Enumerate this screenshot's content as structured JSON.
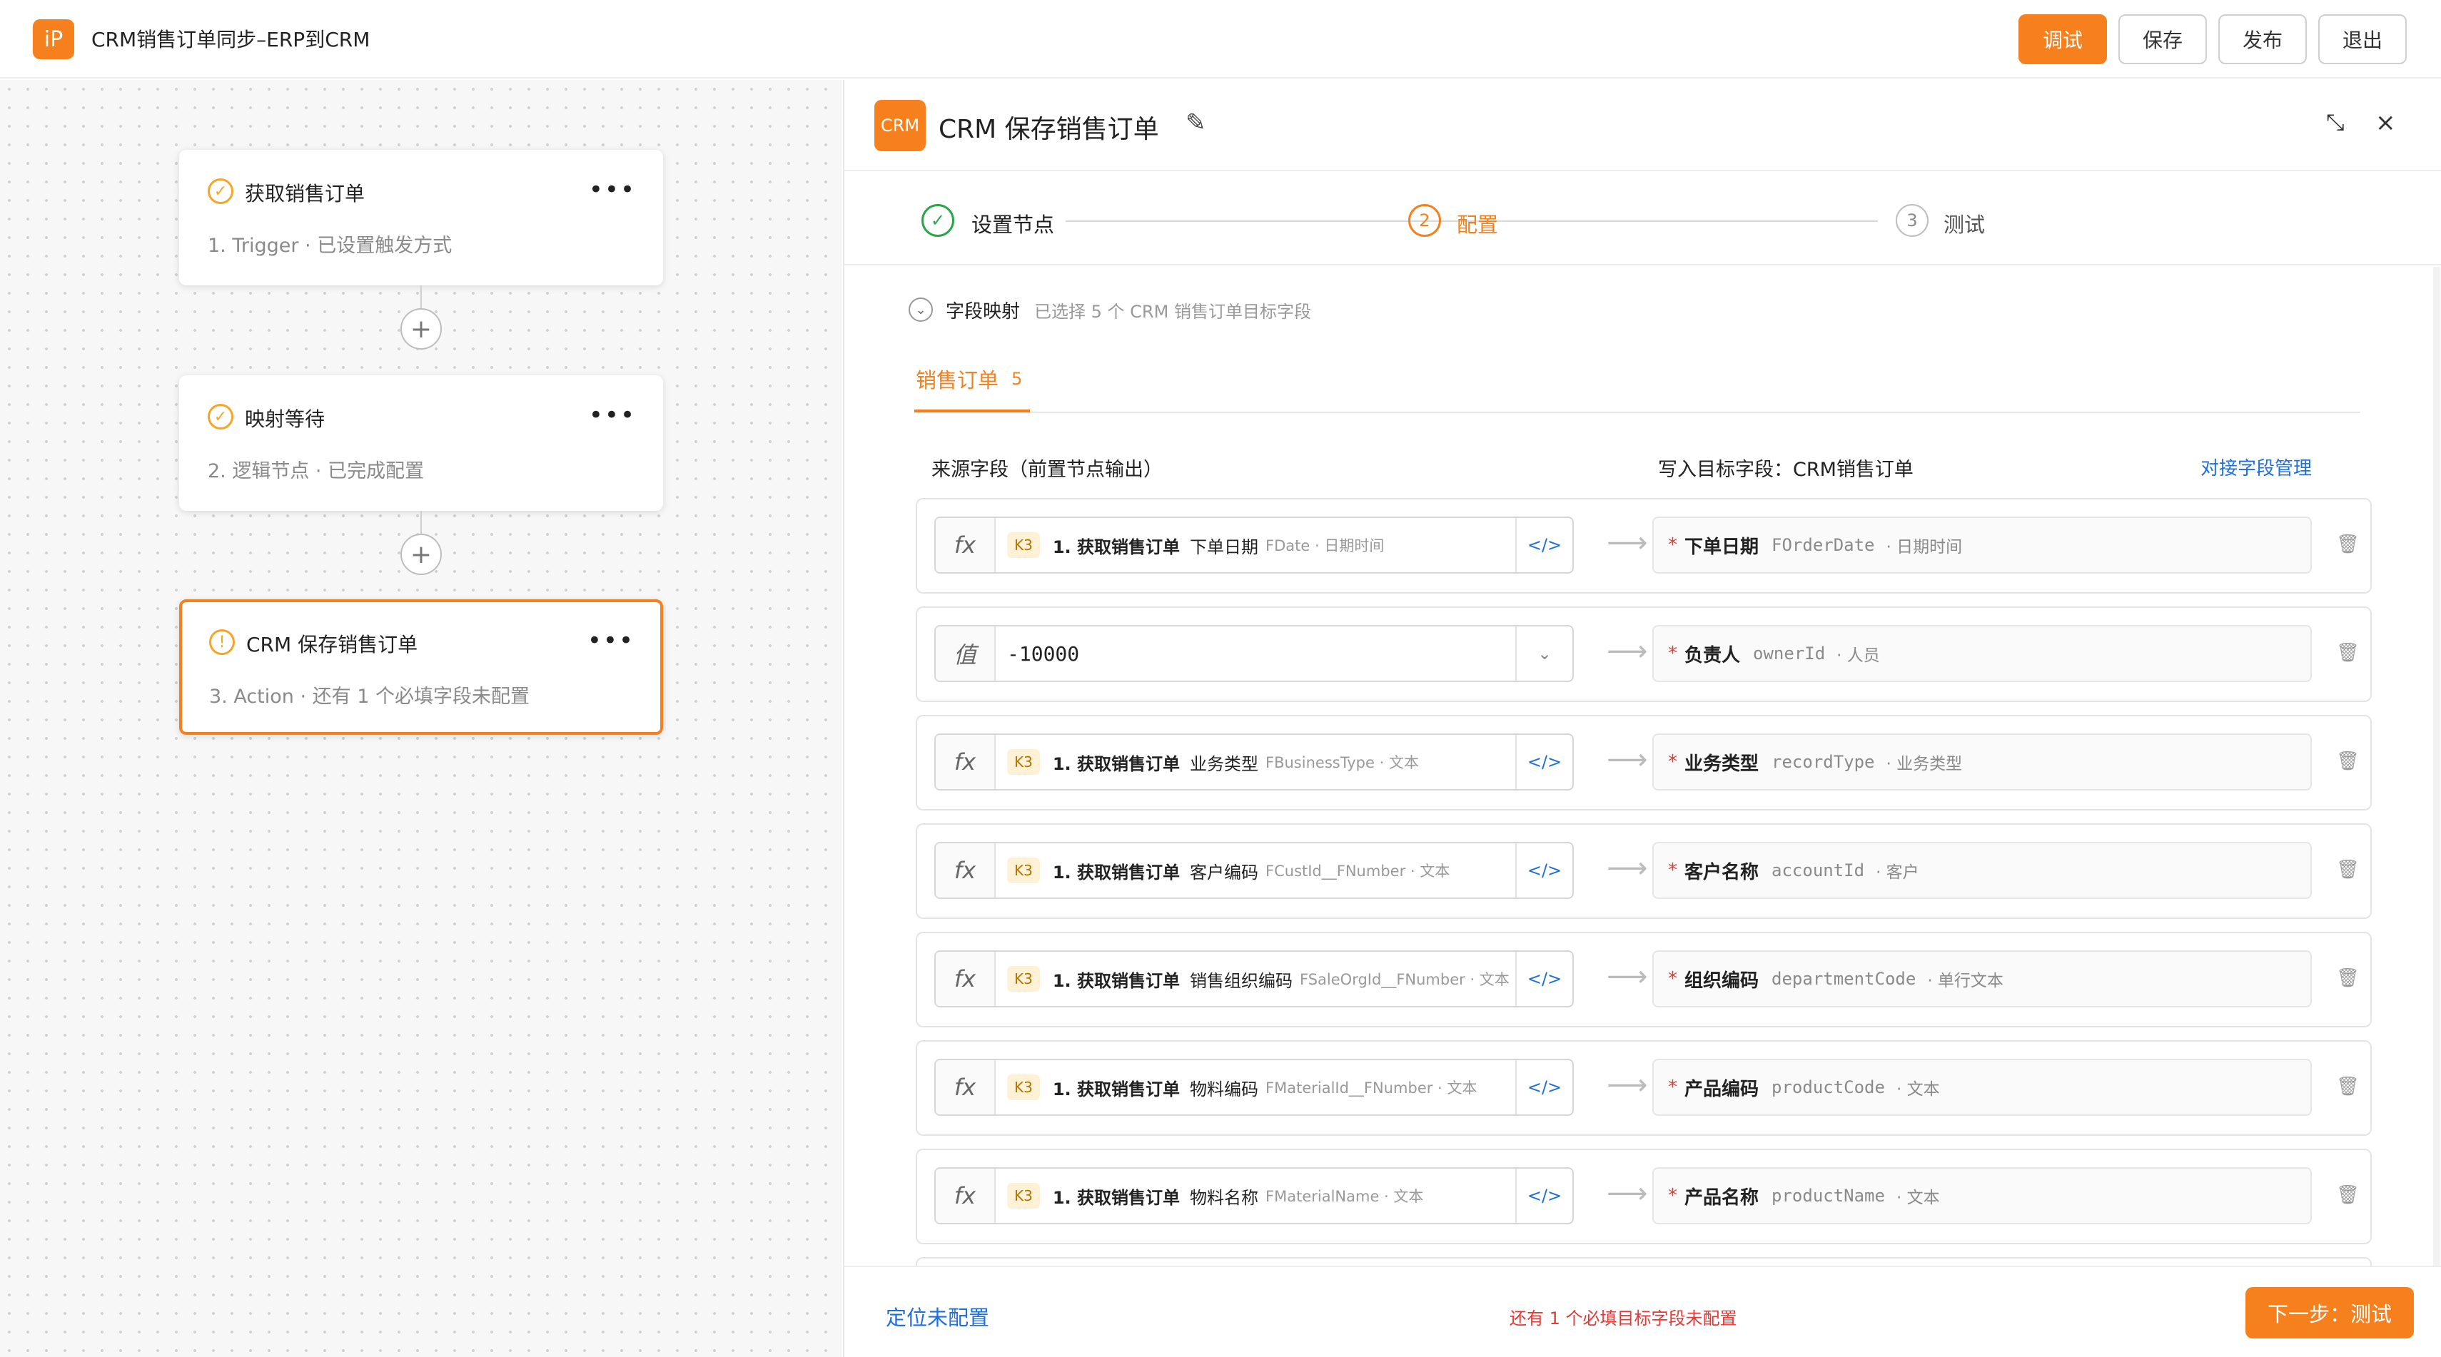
{
  "app": {
    "logo": "iP",
    "title": "CRM销售订单同步–ERP到CRM"
  },
  "toolbar": {
    "debug": "调试",
    "save": "保存",
    "publish": "发布",
    "exit": "退出"
  },
  "workflow": {
    "nodes": [
      {
        "title": "获取销售订单",
        "subtitle": "1. Trigger · 已设置触发方式",
        "status": "done",
        "icon": "check-circle-icon"
      },
      {
        "title": "映射等待",
        "subtitle": "2. 逻辑节点 · 已完成配置",
        "status": "done",
        "icon": "check-circle-icon"
      },
      {
        "title": "CRM 保存销售订单",
        "subtitle": "3. Action · 还有 1 个必填字段未配置",
        "status": "warning",
        "icon": "warning-circle-icon"
      }
    ],
    "more_symbol": "•••",
    "add_symbol": "+"
  },
  "panel": {
    "logo": "CRM",
    "title": "CRM 保存销售订单",
    "steps": [
      {
        "num": "✓",
        "label": "设置节点",
        "state": "done"
      },
      {
        "num": "2",
        "label": "配置",
        "state": "active"
      },
      {
        "num": "3",
        "label": "测试",
        "state": "todo"
      }
    ],
    "section": {
      "title": "字段映射",
      "subtitle": "已选择 5 个 CRM 销售订单目标字段"
    },
    "tab": {
      "label": "销售订单",
      "count": "5"
    },
    "columns": {
      "source": "来源字段（前置节点输出）",
      "target": "写入目标字段：CRM销售订单",
      "manage_link": "对接字段管理"
    },
    "rows": [
      {
        "mode": "fx",
        "tag": "K3",
        "node": "1. 获取销售订单",
        "field": "下单日期",
        "meta": "FDate · 日期时间",
        "value": "",
        "end": "</>",
        "target_name": "下单日期",
        "target_code": "FOrderDate",
        "target_type": "· 日期时间"
      },
      {
        "mode": "值",
        "tag": "",
        "node": "",
        "field": "",
        "meta": "",
        "value": "-10000",
        "end": "⌄",
        "target_name": "负责人",
        "target_code": "ownerId",
        "target_type": "· 人员"
      },
      {
        "mode": "fx",
        "tag": "K3",
        "node": "1. 获取销售订单",
        "field": "业务类型",
        "meta": "FBusinessType · 文本",
        "value": "",
        "end": "</>",
        "target_name": "业务类型",
        "target_code": "recordType",
        "target_type": "· 业务类型"
      },
      {
        "mode": "fx",
        "tag": "K3",
        "node": "1. 获取销售订单",
        "field": "客户编码",
        "meta": "FCustId__FNumber · 文本",
        "value": "",
        "end": "</>",
        "target_name": "客户名称",
        "target_code": "accountId",
        "target_type": "· 客户"
      },
      {
        "mode": "fx",
        "tag": "K3",
        "node": "1. 获取销售订单",
        "field": "销售组织编码",
        "meta": "FSaleOrgId__FNumber · 文本",
        "value": "",
        "end": "</>",
        "target_name": "组织编码",
        "target_code": "departmentCode",
        "target_type": "· 单行文本"
      },
      {
        "mode": "fx",
        "tag": "K3",
        "node": "1. 获取销售订单",
        "field": "物料编码",
        "meta": "FMaterialId__FNumber · 文本",
        "value": "",
        "end": "</>",
        "target_name": "产品编码",
        "target_code": "productCode",
        "target_type": "· 文本"
      },
      {
        "mode": "fx",
        "tag": "K3",
        "node": "1. 获取销售订单",
        "field": "物料名称",
        "meta": "FMaterialName · 文本",
        "value": "",
        "end": "</>",
        "target_name": "产品名称",
        "target_code": "productName",
        "target_type": "· 文本"
      }
    ],
    "footer": {
      "locate": "定位未配置",
      "warning": "还有 1 个必填目标字段未配置",
      "next": "下一步：测试"
    }
  },
  "colors": {
    "accent": "#f7801e",
    "link": "#1f6fde",
    "success": "#2aa64a",
    "error": "#e53935"
  }
}
